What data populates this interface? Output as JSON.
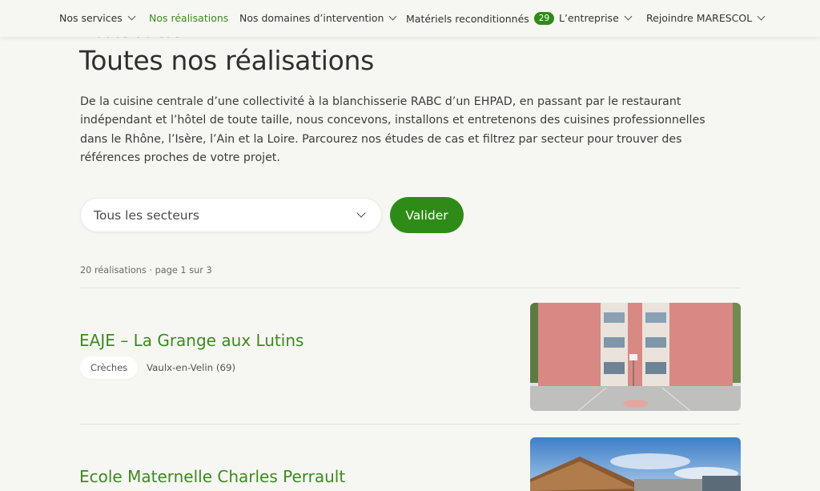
{
  "nav": {
    "items": [
      {
        "label": "Nos services",
        "dropdown": true
      },
      {
        "label": "Nos réalisations",
        "active": true
      },
      {
        "label": "Nos domaines d’intervention",
        "dropdown": true
      },
      {
        "label": "Matériels reconditionnés",
        "badge": "29"
      },
      {
        "label": "L’entreprise",
        "dropdown": true
      },
      {
        "label": "Rejoindre MARESCOL",
        "dropdown": true
      }
    ]
  },
  "page": {
    "kicker": "Etudes de cas",
    "title": "Toutes nos réalisations",
    "intro": "De la cuisine centrale d’une collectivité à la blanchisserie RABC d’un EHPAD, en passant par le restaurant indépendant et l’hôtel de toute taille, nous concevons, installons et entretenons des cuisines professionnelles dans le Rhône, l’Isère, l’Ain et la Loire. Parcourez nos études de cas et filtrez par secteur pour trouver des références proches de votre projet."
  },
  "filter": {
    "selected": "Tous les secteurs",
    "submit_label": "Valider"
  },
  "results": {
    "count_text": "20 réalisations · page 1 sur 3"
  },
  "projects": [
    {
      "title": "EAJE – La Grange aux Lutins",
      "sector": "Crèches",
      "location": "Vaulx-en-Velin (69)"
    },
    {
      "title": "Ecole Maternelle Charles Perrault"
    }
  ],
  "colors": {
    "accent": "#2e8b17",
    "link": "#3d8a20",
    "background": "#f6f7f2"
  }
}
